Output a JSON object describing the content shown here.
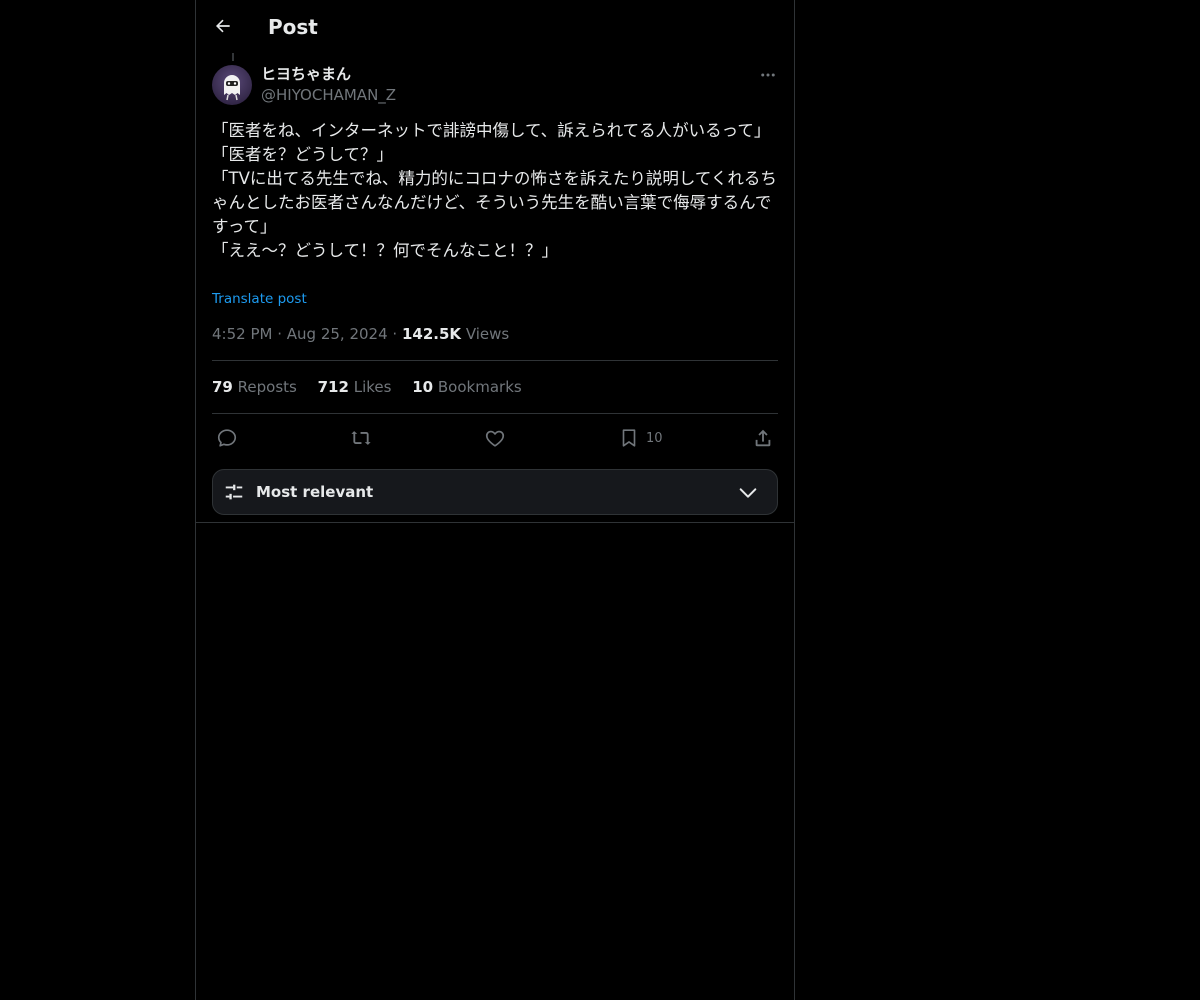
{
  "header": {
    "title": "Post",
    "back_icon": "arrow-left-icon"
  },
  "author": {
    "display_name": "ヒヨちゃまん",
    "handle": "@HIYOCHAMAN_Z",
    "avatar_icon": "ghost-avatar"
  },
  "post": {
    "lines": [
      "「医者をね、インターネットで誹謗中傷して、訴えられてる人がいるって」",
      "「医者を？どうして？」",
      "「TVに出てる先生でね、精力的にコロナの怖さを訴えたり説明してくれるちゃんとしたお医者さんなんだけど、そういう先生を酷い言葉で侮辱するんですって」",
      "「ええ〜？どうして！？何でそんなこと！？」"
    ],
    "translate_label": "Translate post",
    "time": "4:52 PM",
    "date": "Aug 25, 2024",
    "views_count": "142.5K",
    "views_label": "Views"
  },
  "stats": {
    "reposts_count": "79",
    "reposts_label": "Reposts",
    "likes_count": "712",
    "likes_label": "Likes",
    "bookmarks_count": "10",
    "bookmarks_label": "Bookmarks"
  },
  "actions": {
    "bookmark_count": "10"
  },
  "sort": {
    "label": "Most relevant"
  },
  "colors": {
    "background": "#000000",
    "text": "#e7e9ea",
    "muted": "#71767b",
    "accent": "#1d9bf0",
    "border": "#2f3336"
  }
}
